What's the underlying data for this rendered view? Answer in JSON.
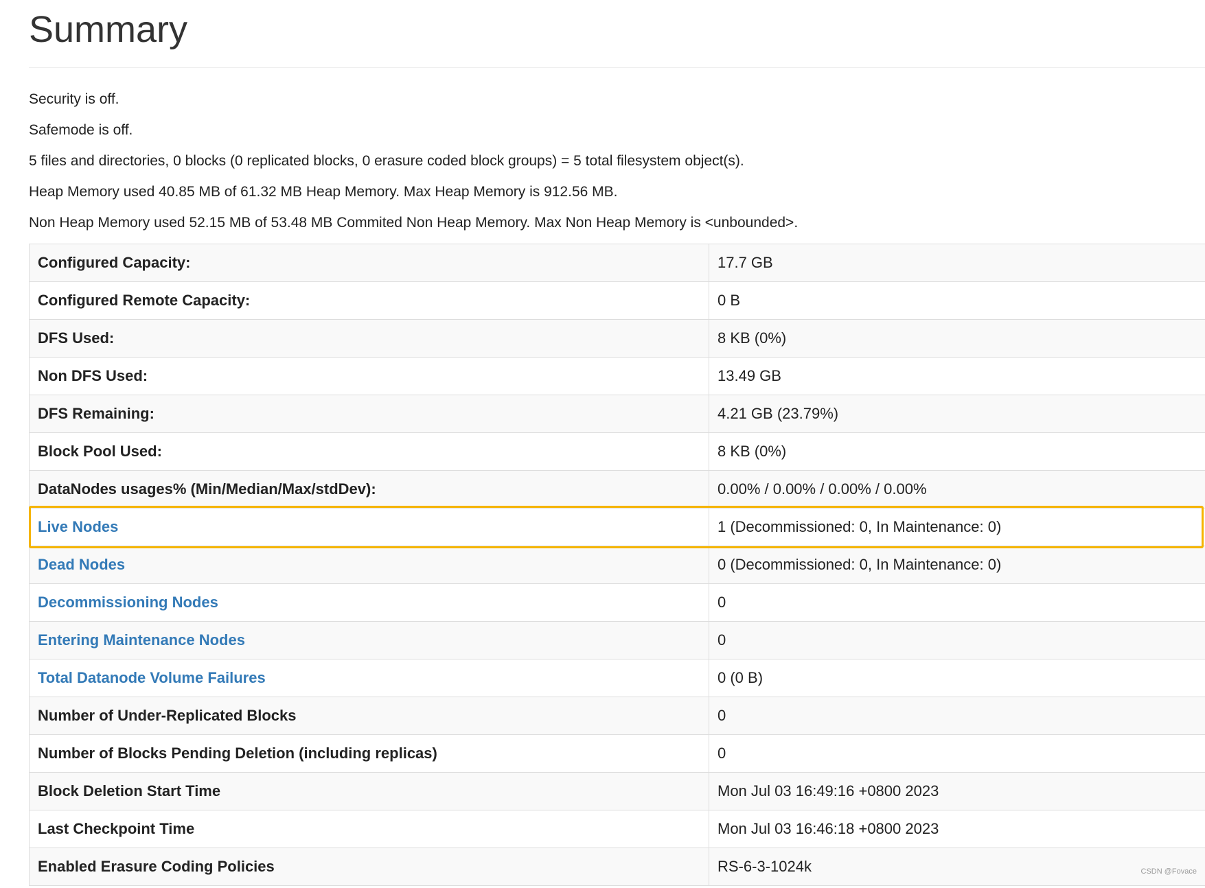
{
  "page": {
    "title": "Summary"
  },
  "status_lines": [
    "Security is off.",
    "Safemode is off.",
    "5 files and directories, 0 blocks (0 replicated blocks, 0 erasure coded block groups) = 5 total filesystem object(s).",
    "Heap Memory used 40.85 MB of 61.32 MB Heap Memory. Max Heap Memory is 912.56 MB.",
    "Non Heap Memory used 52.15 MB of 53.48 MB Commited Non Heap Memory. Max Non Heap Memory is <unbounded>."
  ],
  "summary_table": {
    "rows": [
      {
        "label": "Configured Capacity:",
        "value": "17.7 GB"
      },
      {
        "label": "Configured Remote Capacity:",
        "value": "0 B"
      },
      {
        "label": "DFS Used:",
        "value": "8 KB (0%)"
      },
      {
        "label": "Non DFS Used:",
        "value": "13.49 GB"
      },
      {
        "label": "DFS Remaining:",
        "value": "4.21 GB (23.79%)"
      },
      {
        "label": "Block Pool Used:",
        "value": "8 KB (0%)"
      },
      {
        "label": "DataNodes usages% (Min/Median/Max/stdDev):",
        "value": "0.00% / 0.00% / 0.00% / 0.00%"
      },
      {
        "label": "Live Nodes",
        "value": "1 (Decommissioned: 0, In Maintenance: 0)"
      },
      {
        "label": "Dead Nodes",
        "value": "0 (Decommissioned: 0, In Maintenance: 0)"
      },
      {
        "label": "Decommissioning Nodes",
        "value": "0"
      },
      {
        "label": "Entering Maintenance Nodes",
        "value": "0"
      },
      {
        "label": "Total Datanode Volume Failures",
        "value": "0 (0 B)"
      },
      {
        "label": "Number of Under-Replicated Blocks",
        "value": "0"
      },
      {
        "label": "Number of Blocks Pending Deletion (including replicas)",
        "value": "0"
      },
      {
        "label": "Block Deletion Start Time",
        "value": "Mon Jul 03 16:49:16 +0800 2023"
      },
      {
        "label": "Last Checkpoint Time",
        "value": "Mon Jul 03 16:46:18 +0800 2023"
      },
      {
        "label": "Enabled Erasure Coding Policies",
        "value": "RS-6-3-1024k"
      }
    ]
  },
  "colors": {
    "link": "#337ab7",
    "highlight": "#f5b400",
    "stripe": "#f9f9f9",
    "border": "#dddddd"
  },
  "watermark": "CSDN @Fovace"
}
